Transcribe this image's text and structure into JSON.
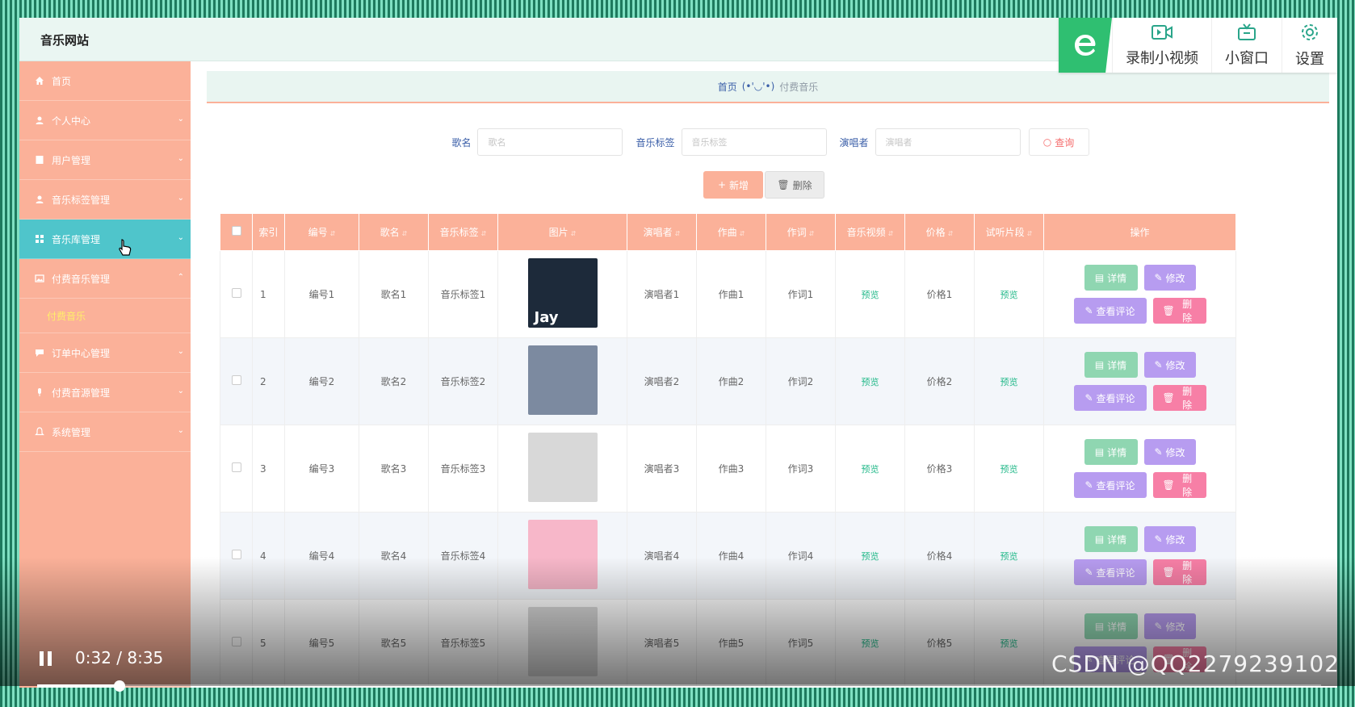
{
  "header": {
    "site_title": "音乐网站"
  },
  "toolbar": {
    "record": "录制小视频",
    "mini": "小窗口",
    "settings": "设置"
  },
  "sidebar": {
    "items": [
      {
        "label": "首页",
        "icon": "home-icon"
      },
      {
        "label": "个人中心",
        "icon": "user-icon"
      },
      {
        "label": "用户管理",
        "icon": "doc-icon"
      },
      {
        "label": "音乐标签管理",
        "icon": "user-icon"
      },
      {
        "label": "音乐库管理",
        "icon": "grid-icon"
      },
      {
        "label": "付费音乐管理",
        "icon": "image-icon"
      },
      {
        "label": "订单中心管理",
        "icon": "chat-icon"
      },
      {
        "label": "付费音源管理",
        "icon": "mic-icon"
      },
      {
        "label": "系统管理",
        "icon": "bell-icon"
      }
    ],
    "submenu_label": "付费音乐"
  },
  "breadcrumb": {
    "home": "首页",
    "face": "(•'◡'•)",
    "current": "付费音乐"
  },
  "search": {
    "song_label": "歌名",
    "song_placeholder": "歌名",
    "tag_label": "音乐标签",
    "tag_placeholder": "音乐标签",
    "singer_label": "演唱者",
    "singer_placeholder": "演唱者",
    "query_label": "查询"
  },
  "actions": {
    "add": "新增",
    "delete": "删除"
  },
  "table": {
    "headers": {
      "index": "索引",
      "code": "编号",
      "song": "歌名",
      "tag": "音乐标签",
      "image": "图片",
      "singer": "演唱者",
      "composer": "作曲",
      "lyricist": "作词",
      "video": "音乐视频",
      "price": "价格",
      "clip": "试听片段",
      "ops": "操作"
    },
    "rows": [
      {
        "index": "1",
        "code": "编号1",
        "song": "歌名1",
        "tag": "音乐标签1",
        "singer": "演唱者1",
        "composer": "作曲1",
        "lyricist": "作词1",
        "video": "预览",
        "price": "价格1",
        "clip": "预览",
        "cover_label": "Jay",
        "cover_color": "#1d2a3a"
      },
      {
        "index": "2",
        "code": "编号2",
        "song": "歌名2",
        "tag": "音乐标签2",
        "singer": "演唱者2",
        "composer": "作曲2",
        "lyricist": "作词2",
        "video": "预览",
        "price": "价格2",
        "clip": "预览",
        "cover_label": "",
        "cover_color": "#7c8aa0"
      },
      {
        "index": "3",
        "code": "编号3",
        "song": "歌名3",
        "tag": "音乐标签3",
        "singer": "演唱者3",
        "composer": "作曲3",
        "lyricist": "作词3",
        "video": "预览",
        "price": "价格3",
        "clip": "预览",
        "cover_label": "",
        "cover_color": "#d8d8d8"
      },
      {
        "index": "4",
        "code": "编号4",
        "song": "歌名4",
        "tag": "音乐标签4",
        "singer": "演唱者4",
        "composer": "作曲4",
        "lyricist": "作词4",
        "video": "预览",
        "price": "价格4",
        "clip": "预览",
        "cover_label": "",
        "cover_color": "#f7b7c9"
      },
      {
        "index": "5",
        "code": "编号5",
        "song": "歌名5",
        "tag": "音乐标签5",
        "singer": "演唱者5",
        "composer": "作曲5",
        "lyricist": "作词5",
        "video": "预览",
        "price": "价格5",
        "clip": "预览",
        "cover_label": "",
        "cover_color": "#d8d8d8"
      }
    ],
    "op_labels": {
      "detail": "详情",
      "edit": "修改",
      "review": "查看评论",
      "remove": "删除"
    }
  },
  "player": {
    "time": "0:32 / 8:35",
    "progress": 0.064
  },
  "watermark": "CSDN @QQ2279239102",
  "colors": {
    "sidebar": "#fbb199",
    "active": "#4fc5cb",
    "accent": "#2fbf71"
  }
}
